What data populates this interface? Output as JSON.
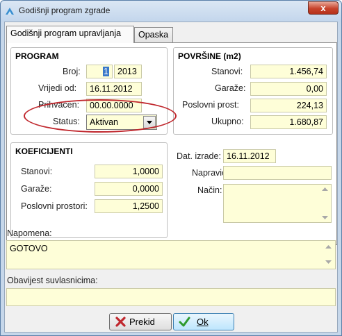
{
  "window": {
    "title": "Godišnji program zgrade",
    "close_label": "x"
  },
  "tabs": [
    {
      "label": "Godišnji program upravljanja",
      "active": true
    },
    {
      "label": "Opaska",
      "active": false
    }
  ],
  "program": {
    "title": "PROGRAM",
    "broj_label": "Broj:",
    "broj_value": "1",
    "broj_year": "2013",
    "vrijedi_label": "Vrijedi od:",
    "vrijedi_value": "16.11.2012",
    "prihvacen_label": "Prihvaćen:",
    "prihvacen_value": "00.00.0000",
    "status_label": "Status:",
    "status_value": "Aktivan"
  },
  "povrsine": {
    "title": "POVRŠINE (m2)",
    "rows": [
      {
        "label": "Stanovi:",
        "value": "1.456,74"
      },
      {
        "label": "Garaže:",
        "value": "0,00"
      },
      {
        "label": "Poslovni prost:",
        "value": "224,13"
      },
      {
        "label": "Ukupno:",
        "value": "1.680,87"
      }
    ]
  },
  "koeficijenti": {
    "title": "KOEFICIJENTI",
    "rows": [
      {
        "label": "Stanovi:",
        "value": "1,0000"
      },
      {
        "label": "Garaže:",
        "value": "0,0000"
      },
      {
        "label": "Poslovni prostori:",
        "value": "1,2500"
      }
    ]
  },
  "meta": {
    "dat_izrade_label": "Dat. izrade:",
    "dat_izrade_value": "16.11.2012",
    "napravio_label": "Napravio:",
    "napravio_value": "",
    "nacin_label": "Način:",
    "nacin_value": ""
  },
  "napomena": {
    "label": "Napomena:",
    "value": "GOTOVO"
  },
  "obavijest": {
    "label": "Obavijest suvlasnicima:",
    "value": ""
  },
  "buttons": {
    "prekid_label": "Prekid",
    "ok_label": "Ok"
  },
  "colors": {
    "field_bg": "#fefed8",
    "annotation": "#c0272d",
    "cancel_icon": "#c0272d",
    "ok_icon": "#2e9a2e"
  }
}
